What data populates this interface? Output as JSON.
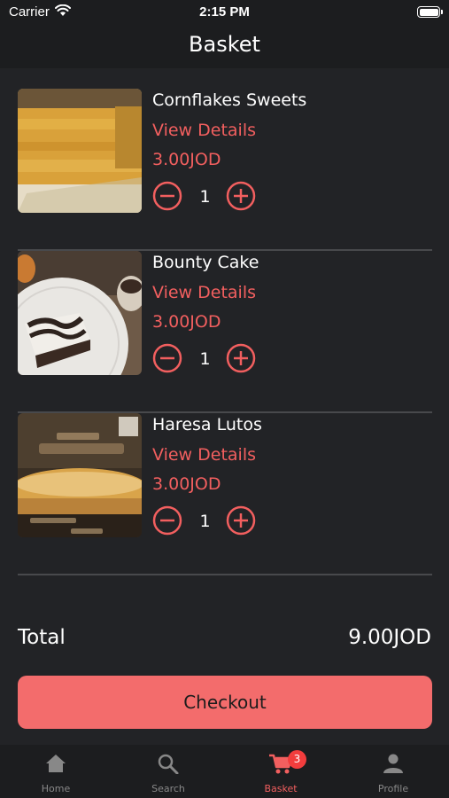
{
  "status_bar": {
    "carrier": "Carrier",
    "time": "2:15 PM"
  },
  "header": {
    "title": "Basket"
  },
  "items": [
    {
      "name": "Cornflakes Sweets",
      "details_label": "View Details",
      "price": "3.00JOD",
      "quantity": "1"
    },
    {
      "name": "Bounty Cake",
      "details_label": "View Details",
      "price": "3.00JOD",
      "quantity": "1"
    },
    {
      "name": "Haresa Lutos",
      "details_label": "View Details",
      "price": "3.00JOD",
      "quantity": "1"
    }
  ],
  "summary": {
    "total_label": "Total",
    "total_value": "9.00JOD"
  },
  "checkout_label": "Checkout",
  "tabs": [
    {
      "label": "Home",
      "icon": "home-icon"
    },
    {
      "label": "Search",
      "icon": "search-icon"
    },
    {
      "label": "Basket",
      "icon": "cart-icon",
      "badge": "3"
    },
    {
      "label": "Profile",
      "icon": "person-icon"
    }
  ],
  "colors": {
    "accent": "#f25f5f",
    "button": "#f36c6c",
    "background": "#222326",
    "badge": "#f23d3d"
  }
}
